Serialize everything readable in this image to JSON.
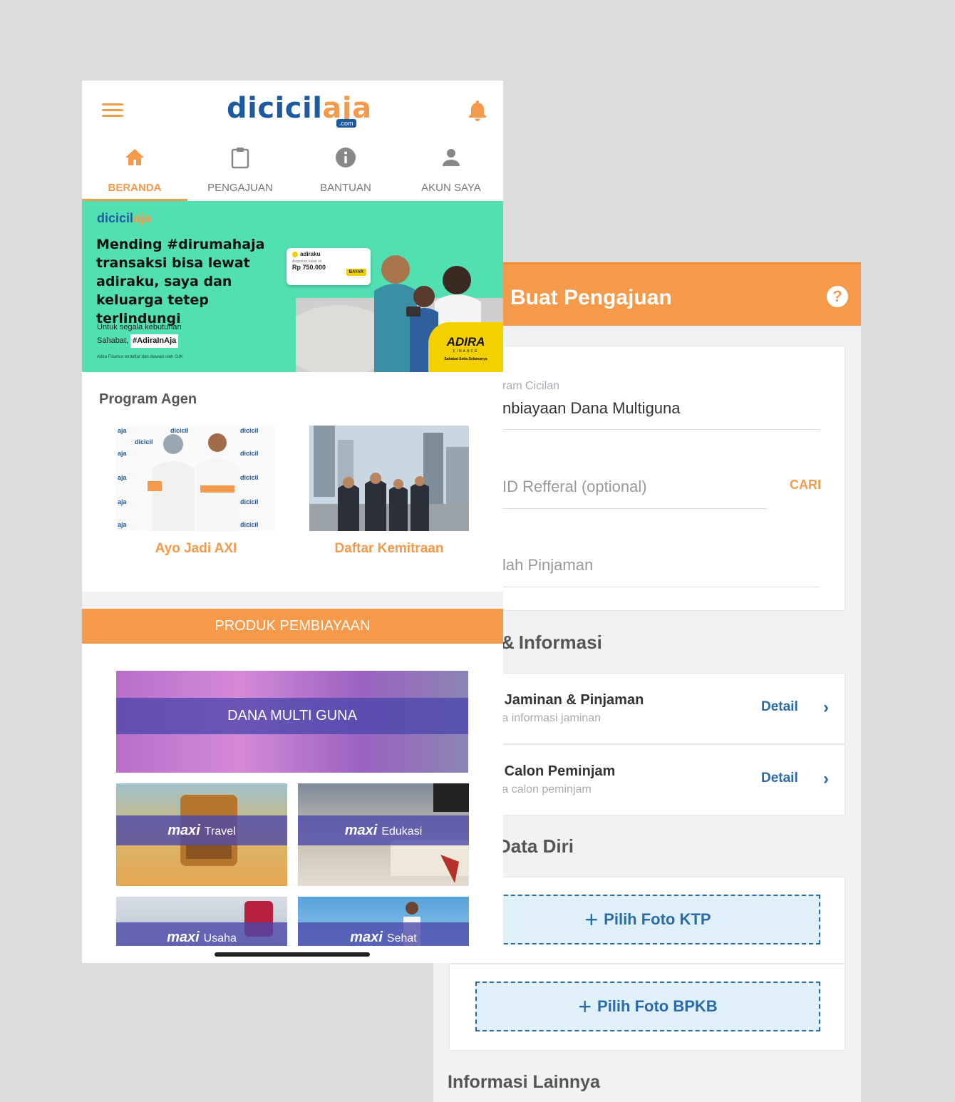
{
  "pengajuan": {
    "title": "Buat Pengajuan",
    "help_icon": "help-circle-icon",
    "program_label": "ram Cicilan",
    "program_value": "nbiayaan Dana Multiguna",
    "referral_placeholder": "ID Refferal (optional)",
    "cari_label": "CARI",
    "pinjaman_placeholder": "lah Pinjaman",
    "section_informasi": "Informasi",
    "rows": [
      {
        "title": "a Jaminan & Pinjaman",
        "subtitle": "ata informasi jaminan",
        "action": "Detail"
      },
      {
        "title": "a Calon Peminjam",
        "subtitle": "ata calon peminjam",
        "action": "Detail"
      }
    ],
    "section_data_diri": "Data Diri",
    "upload_ktp": "Pilih Foto KTP",
    "upload_bpkb": "Pilih Foto BPKB",
    "section_lainnya": "Informasi Lainnya"
  },
  "home": {
    "logo_main": "dicicil",
    "logo_accent": "aja",
    "logo_suffix": ".com",
    "tabs": [
      {
        "label": "BERANDA",
        "icon": "home-icon",
        "active": true
      },
      {
        "label": "PENGAJUAN",
        "icon": "clipboard-icon",
        "active": false
      },
      {
        "label": "BANTUAN",
        "icon": "info-icon",
        "active": false
      },
      {
        "label": "AKUN SAYA",
        "icon": "user-icon",
        "active": false
      }
    ],
    "banner": {
      "logo_main": "dicicil",
      "logo_accent": "aja",
      "headline": "Mending #dirumahaja transaksi bisa lewat adiraku, saya dan keluarga tetep terlindungi",
      "sub_line1": "Untuk segala kebutuhan",
      "sub_line2": "Sahabat,",
      "hashtag": "#AdiraInAja",
      "fine_print": "Adira Finance terdaftar dan diawasi oleh OJK",
      "app_name": "adiraku",
      "installment_label": "Angsuran bulan ini",
      "amount": "Rp 750.000",
      "pay_label": "BAYAR",
      "adira_name": "ADIRA",
      "adira_sub": "FINANCE",
      "adira_tagline": "Sahabat Setia Selamanya"
    },
    "program_title": "Program Agen",
    "programs": [
      {
        "label": "Ayo Jadi AXI"
      },
      {
        "label": "Daftar Kemitraan"
      }
    ],
    "produk_title": "PRODUK PEMBIAYAAN",
    "products": [
      {
        "name": "DANA MULTI GUNA"
      },
      {
        "brand": "maxi",
        "name": "Travel"
      },
      {
        "brand": "maxi",
        "name": "Edukasi"
      },
      {
        "brand": "maxi",
        "name": "Usaha"
      },
      {
        "brand": "maxi",
        "name": "Sehat"
      }
    ]
  },
  "colors": {
    "orange": "#f5994a",
    "blue": "#1e5aa0",
    "banner_green": "#52dfb2",
    "strip_purple": "#4a46aa"
  }
}
